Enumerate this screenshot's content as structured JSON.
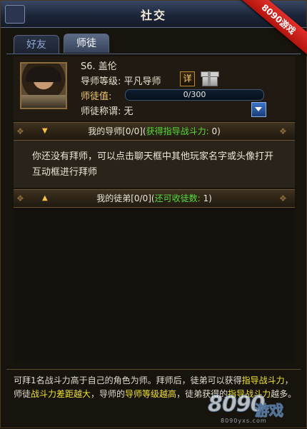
{
  "window": {
    "title": "社交"
  },
  "ribbon": {
    "text": "8090游戏"
  },
  "tabs": [
    {
      "label": "好友",
      "active": false
    },
    {
      "label": "师徒",
      "active": true
    }
  ],
  "profile": {
    "name": "S6. 盖伦",
    "level_label": "导师等级:",
    "level_value": "平凡导师",
    "detail_label": "详",
    "value_label": "师徒值:",
    "value_text": "0/300",
    "progress": 0,
    "title_label": "师徒称谓:",
    "title_value": "无"
  },
  "mentor_section": {
    "label_prefix": "我的导师[0/0]",
    "label_paren_open": "(",
    "label_green": "获得指导战斗力:",
    "label_count": " 0)",
    "expanded": true
  },
  "message": "你还没有拜师，可以点击聊天框中其他玩家名字或头像打开互动框进行拜师",
  "apprentice_section": {
    "label_prefix": "我的徒弟[0/0]",
    "label_paren_open": "(",
    "label_green": "还可收徒数:",
    "label_count": " 1)",
    "expanded": false
  },
  "footer": {
    "p1": "可拜1名战斗力高于自己的角色为师。拜师后，徒弟可以获得",
    "h1": "指导战斗力",
    "p2": "，师徒",
    "h2": "战斗力差距越大",
    "p3": "，导师的",
    "h3": "导师等级越高",
    "p4": "，徒弟获得的",
    "h4": "指导战斗力",
    "p5": "越多。"
  },
  "watermark": {
    "digits": "8090",
    "cn": "游戏",
    "url": "8090yxs.com"
  },
  "colors": {
    "highlight_green": "#55dd3c",
    "highlight_yellow": "#f1e233",
    "ribbon_red": "#d9261f"
  }
}
